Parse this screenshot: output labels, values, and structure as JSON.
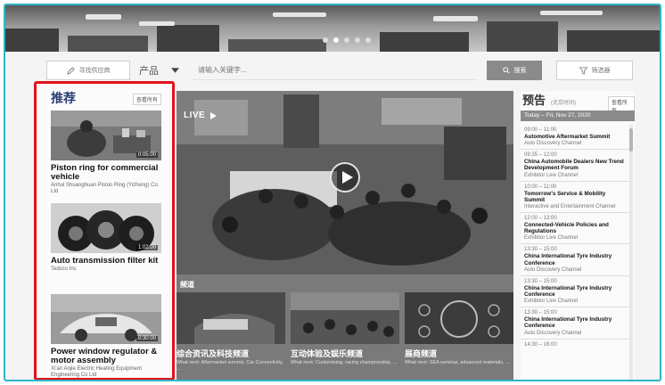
{
  "search": {
    "shortcut_label": "寻找供应商",
    "category": "产品",
    "placeholder": "请输入关键字...",
    "search_label": "搜索",
    "filter_label": "筛选器"
  },
  "recommend": {
    "title": "推荐",
    "more_label": "查看所有",
    "items": [
      {
        "name": "Piston ring for commercial vehicle",
        "company": "Anhui Shuanghuan Piston Ring (Yizheng) Co. Ltd",
        "duration": "0:05:00"
      },
      {
        "name": "Auto transmission filter kit",
        "company": "Tedsco Inc",
        "duration": "1:02:00"
      },
      {
        "name": "Power window regulator & motor assembly",
        "company": "Xi'an Aojie Electric Heating Equipment Engineering Co Ltd",
        "duration": "0:30:00"
      }
    ]
  },
  "video": {
    "live_label": "LIVE"
  },
  "channels": {
    "header": "频道",
    "items": [
      {
        "name": "综合资讯及科技频道",
        "sub": "What next: Aftermarket summit, Car Connectivity, ..."
      },
      {
        "name": "互动体验及娱乐频道",
        "sub": "What next: Customising, racing championship, ..."
      },
      {
        "name": "展商频道",
        "sub": "What next: SEA seminar, advanced materials, ..."
      }
    ]
  },
  "preview": {
    "title": "预告",
    "note": "(北京时间)",
    "more_label": "查看所有",
    "date_bar": "Today – Fri, Nov 27, 2020",
    "events": [
      {
        "time": "09:00 – 11:00",
        "title": "Automotive Aftermarket Summit",
        "channel": "Auto Discovery Channel"
      },
      {
        "time": "09:35 – 12:00",
        "title": "China Automobile Dealers New Trend Development Forum",
        "channel": "Exhibitor Live Channel"
      },
      {
        "time": "10:00 – 11:00",
        "title": "Tomorrow's Service & Mobility Summit",
        "channel": "Interactive and Entertainment Channel"
      },
      {
        "time": "12:00 – 13:00",
        "title": "Connected-Vehicle Policies and Regulations",
        "channel": "Exhibitor Live Channel"
      },
      {
        "time": "13:30 – 15:00",
        "title": "China International Tyre Industry Conference",
        "channel": "Auto Discovery Channel"
      },
      {
        "time": "13:30 – 15:00",
        "title": "China International Tyre Industry Conference",
        "channel": "Exhibitor Live Channel"
      },
      {
        "time": "13:30 – 15:00",
        "title": "China International Tyre Industry Conference",
        "channel": "Auto Discovery Channel"
      },
      {
        "time": "14:30 – 16:00",
        "title": "",
        "channel": ""
      }
    ]
  }
}
